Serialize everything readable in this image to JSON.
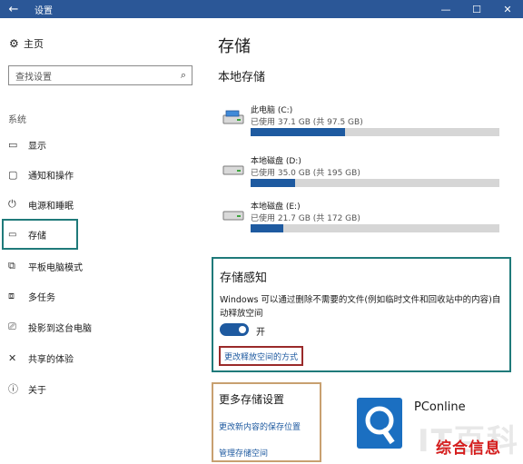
{
  "window": {
    "title": "设置",
    "back": "←",
    "minimize": "—",
    "maximize": "☐",
    "close": "✕"
  },
  "sidebar": {
    "home_label": "主页",
    "search_placeholder": "查找设置",
    "section_label": "系统",
    "items": [
      {
        "label": "显示",
        "icon": "display-icon"
      },
      {
        "label": "通知和操作",
        "icon": "notification-icon"
      },
      {
        "label": "电源和睡眠",
        "icon": "power-icon"
      },
      {
        "label": "存储",
        "icon": "storage-icon"
      },
      {
        "label": "平板电脑模式",
        "icon": "tablet-icon"
      },
      {
        "label": "多任务",
        "icon": "multitask-icon"
      },
      {
        "label": "投影到这台电脑",
        "icon": "project-icon"
      },
      {
        "label": "共享的体验",
        "icon": "share-icon"
      },
      {
        "label": "关于",
        "icon": "info-icon"
      }
    ],
    "active_index": 3
  },
  "main": {
    "title": "存储",
    "local_title": "本地存储",
    "drives": [
      {
        "name": "此电脑 (C:)",
        "used": "已使用 37.1 GB (共 97.5 GB)",
        "fraction": 0.38
      },
      {
        "name": "本地磁盘 (D:)",
        "used": "已使用 35.0 GB (共 195 GB)",
        "fraction": 0.18
      },
      {
        "name": "本地磁盘 (E:)",
        "used": "已使用 21.7 GB (共 172 GB)",
        "fraction": 0.13
      }
    ],
    "storage_sense": {
      "title": "存储感知",
      "description": "Windows 可以通过删除不需要的文件(例如临时文件和回收站中的内容)自动释放空间",
      "toggle_label": "开",
      "toggle_on": true,
      "change_link": "更改释放空间的方式"
    },
    "more_settings": {
      "title": "更多存储设置",
      "link1": "更改新内容的保存位置",
      "link2": "管理存储空间"
    }
  },
  "watermark": {
    "brand": "PConline",
    "big": "IT百科",
    "red": "综合信息"
  },
  "colors": {
    "titlebar": "#2b5797",
    "accent": "#1e5aa0",
    "highlight_teal": "#1f7a7a",
    "highlight_red": "#9a2a2a",
    "highlight_tan": "#c8a070"
  }
}
